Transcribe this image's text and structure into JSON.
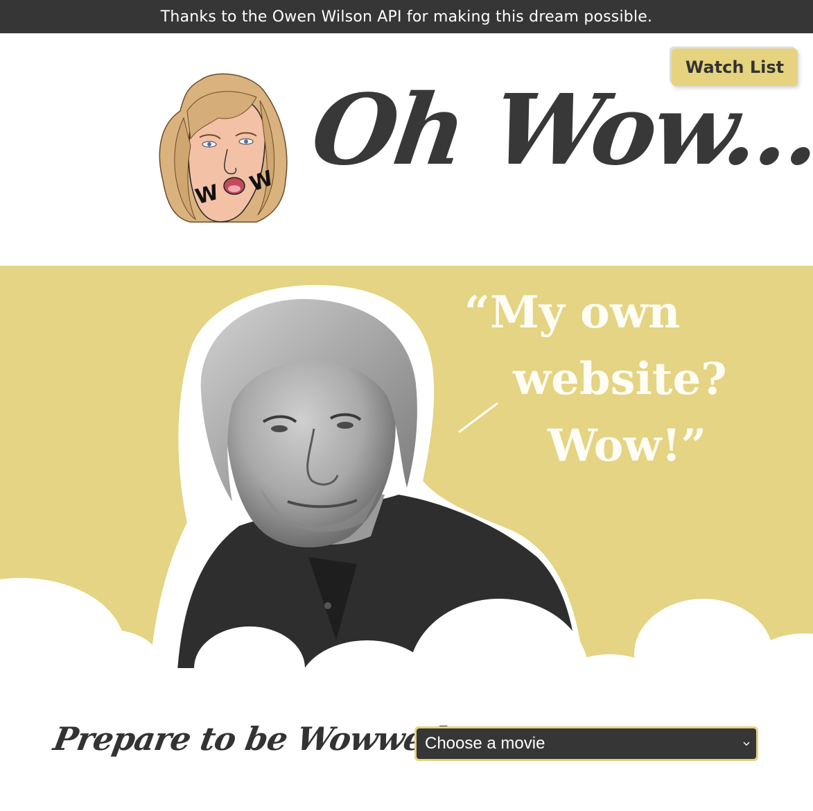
{
  "banner": {
    "text": "Thanks to the Owen Wilson API for making this dream possible."
  },
  "header": {
    "watch_list_label": "Watch List",
    "title": "Oh Wow...",
    "logo_text": "WOW"
  },
  "hero": {
    "quote_line_1": "“My own",
    "quote_line_2": "website?",
    "quote_line_3": "Wow!”"
  },
  "prepare": {
    "title": "Prepare to be Wowwed...",
    "select_value": "Choose a movie"
  },
  "colors": {
    "banner_bg": "#363636",
    "accent_yellow": "#e4d483",
    "button_yellow": "#e6d37f",
    "text_dark": "#333333",
    "quote_white": "#fffdf5"
  },
  "icons": {
    "select_arrow": "chevron-down-icon"
  }
}
